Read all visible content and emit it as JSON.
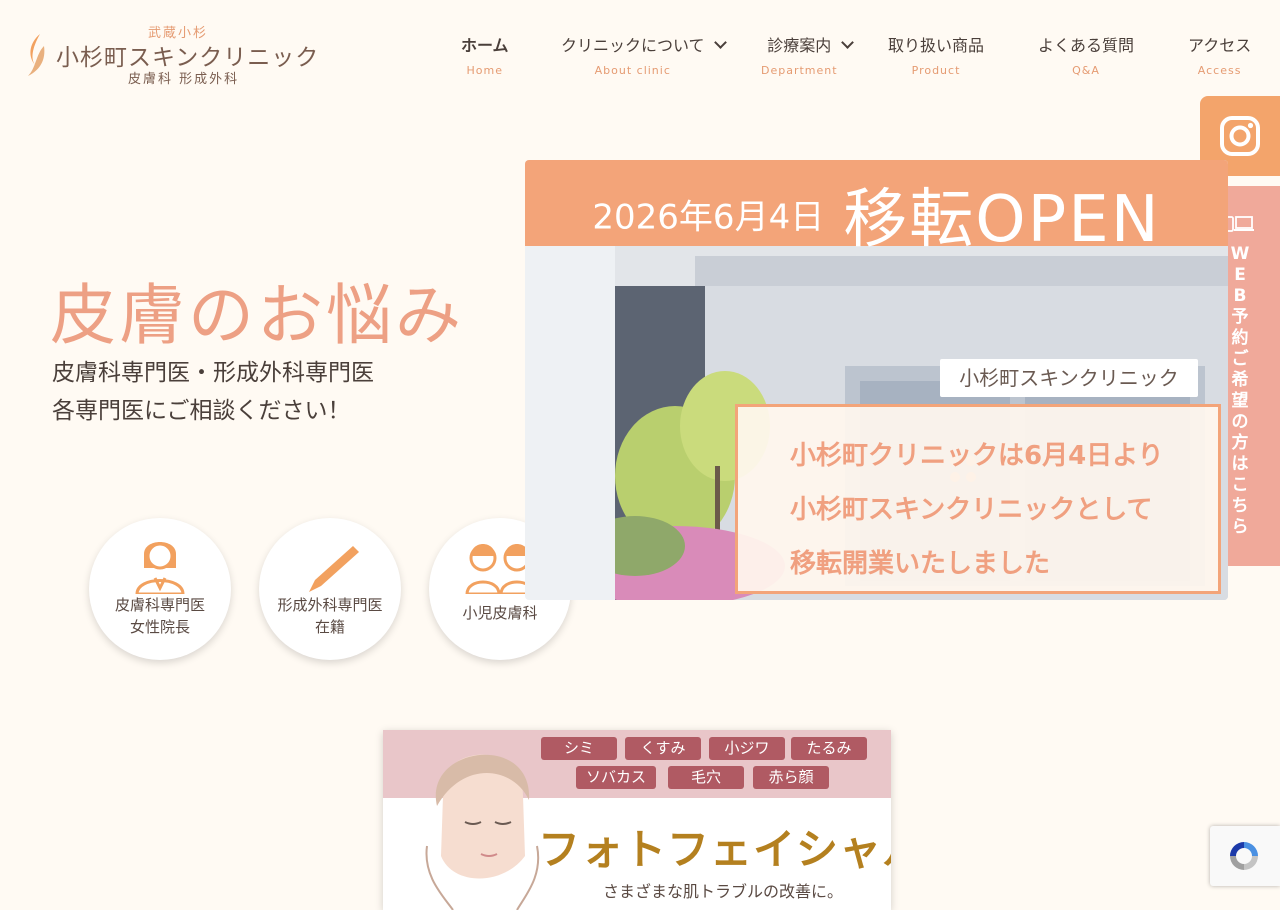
{
  "logo": {
    "sub": "武蔵小杉",
    "name": "小杉町スキンクリニック",
    "dept": "皮膚科 形成外科"
  },
  "nav": [
    {
      "jp": "ホーム",
      "en": "Home"
    },
    {
      "jp": "クリニックについて",
      "en": "About clinic"
    },
    {
      "jp": "診療案内",
      "en": "Department"
    },
    {
      "jp": "取り扱い商品",
      "en": "Product"
    },
    {
      "jp": "よくある質問",
      "en": "Q&A"
    },
    {
      "jp": "アクセス",
      "en": "Access"
    }
  ],
  "side": {
    "web_reserve": "WEB予約ご希望の方はこちら"
  },
  "hero": {
    "title": "皮膚のお悩み",
    "sub_line1": "皮膚科専門医・形成外科専門医",
    "sub_line2": "各専門医にご相談ください！"
  },
  "badges": [
    {
      "line1": "皮膚科専門医",
      "line2": "女性院長"
    },
    {
      "line1": "形成外科専門医",
      "line2": "在籍"
    },
    {
      "line1": "小児皮膚科",
      "line2": ""
    }
  ],
  "banner": {
    "date": "2026年6月4日",
    "open": "移転OPEN",
    "sign": "小杉町スキンクリニック",
    "notice": [
      "小杉町クリニックは6月4日より",
      "小杉町スキンクリニックとして",
      "移転開業いたしました"
    ]
  },
  "photofacial": {
    "tags": [
      "シミ",
      "くすみ",
      "小ジワ",
      "たるみ",
      "ソバカス",
      "毛穴",
      "赤ら顔"
    ],
    "title": "フォトフェイシャル",
    "sub": "さまざまな肌トラブルの改善に。"
  },
  "colors": {
    "accent": "#f3a479",
    "title": "#eda084",
    "background": "#fffaf3"
  }
}
